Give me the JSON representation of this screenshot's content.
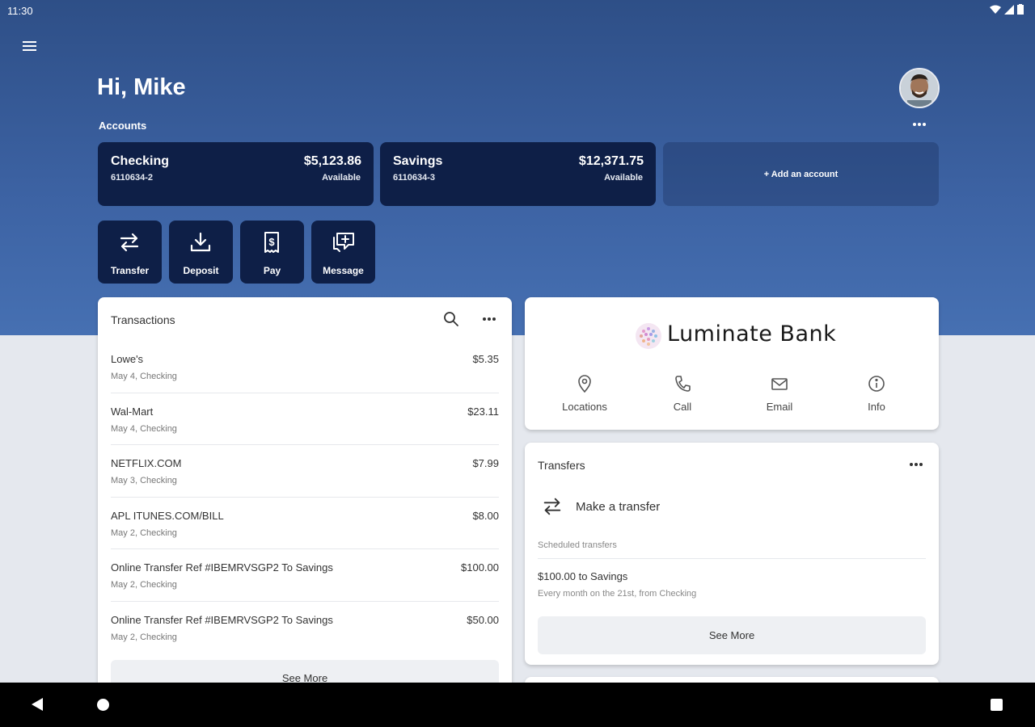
{
  "status_bar": {
    "time": "11:30"
  },
  "header": {
    "greeting": "Hi, Mike",
    "accounts_label": "Accounts",
    "add_account_label": "+ Add an account"
  },
  "accounts": [
    {
      "name": "Checking",
      "number": "6110634-2",
      "balance": "$5,123.86",
      "balance_note": "Available"
    },
    {
      "name": "Savings",
      "number": "6110634-3",
      "balance": "$12,371.75",
      "balance_note": "Available"
    }
  ],
  "quick_actions": [
    {
      "label": "Transfer",
      "icon": "transfer-icon"
    },
    {
      "label": "Deposit",
      "icon": "deposit-icon"
    },
    {
      "label": "Pay",
      "icon": "pay-icon"
    },
    {
      "label": "Message",
      "icon": "message-icon"
    }
  ],
  "transactions": {
    "title": "Transactions",
    "items": [
      {
        "description": "Lowe's",
        "detail": "May 4, Checking",
        "amount": "$5.35"
      },
      {
        "description": "Wal-Mart",
        "detail": "May 4, Checking",
        "amount": "$23.11"
      },
      {
        "description": "NETFLIX.COM",
        "detail": "May 3, Checking",
        "amount": "$7.99"
      },
      {
        "description": "APL ITUNES.COM/BILL",
        "detail": "May 2, Checking",
        "amount": "$8.00"
      },
      {
        "description": "Online Transfer Ref #IBEMRVSGP2 To Savings",
        "detail": "May 2, Checking",
        "amount": "$100.00"
      },
      {
        "description": "Online Transfer Ref #IBEMRVSGP2 To Savings",
        "detail": "May 2, Checking",
        "amount": "$50.00"
      }
    ],
    "see_more": "See More"
  },
  "bank": {
    "name": "Luminate Bank",
    "actions": [
      {
        "label": "Locations",
        "icon": "location-pin-icon"
      },
      {
        "label": "Call",
        "icon": "phone-icon"
      },
      {
        "label": "Email",
        "icon": "email-icon"
      },
      {
        "label": "Info",
        "icon": "info-icon"
      }
    ]
  },
  "transfers": {
    "title": "Transfers",
    "make_transfer": "Make a transfer",
    "scheduled_label": "Scheduled transfers",
    "scheduled": [
      {
        "title": "$100.00 to Savings",
        "detail": "Every month on the 21st, from Checking"
      }
    ],
    "see_more": "See More"
  },
  "colors": {
    "hero_blue": "#3d63a4",
    "card_navy": "#0e1f47",
    "page_bg": "#e5e8ee"
  }
}
